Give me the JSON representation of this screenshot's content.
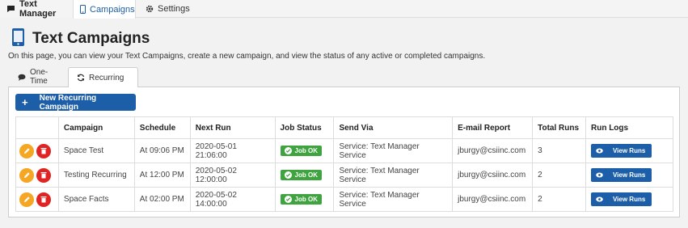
{
  "nav": {
    "brand": "Text Manager",
    "campaigns": "Campaigns",
    "settings": "Settings"
  },
  "page": {
    "title": "Text Campaigns",
    "description": "On this page, you can view your Text Campaigns, create a new campaign, and view the status of any active or completed campaigns."
  },
  "subtabs": {
    "one_time": "One-Time",
    "recurring": "Recurring"
  },
  "new_button": "New Recurring Campaign",
  "table": {
    "headers": [
      "",
      "Campaign",
      "Schedule",
      "Next Run",
      "Job Status",
      "Send Via",
      "E-mail Report",
      "Total Runs",
      "Run Logs"
    ],
    "rows": [
      {
        "campaign": "Space Test",
        "schedule": "At 09:06 PM",
        "next_run": "2020-05-01 21:06:00",
        "status": "Job OK",
        "send_via": "Service: Text Manager Service",
        "email": "jburgy@csiinc.com",
        "total_runs": "3",
        "logs": "View Runs"
      },
      {
        "campaign": "Testing Recurring",
        "schedule": "At 12:00 PM",
        "next_run": "2020-05-02 12:00:00",
        "status": "Job OK",
        "send_via": "Service: Text Manager Service",
        "email": "jburgy@csiinc.com",
        "total_runs": "2",
        "logs": "View Runs"
      },
      {
        "campaign": "Space Facts",
        "schedule": "At 02:00 PM",
        "next_run": "2020-05-02 14:00:00",
        "status": "Job OK",
        "send_via": "Service: Text Manager Service",
        "email": "jburgy@csiinc.com",
        "total_runs": "2",
        "logs": "View Runs"
      }
    ]
  },
  "colors": {
    "primary": "#1c5ea8",
    "edit": "#f5a623",
    "delete": "#e02424",
    "ok": "#3fa43f"
  }
}
